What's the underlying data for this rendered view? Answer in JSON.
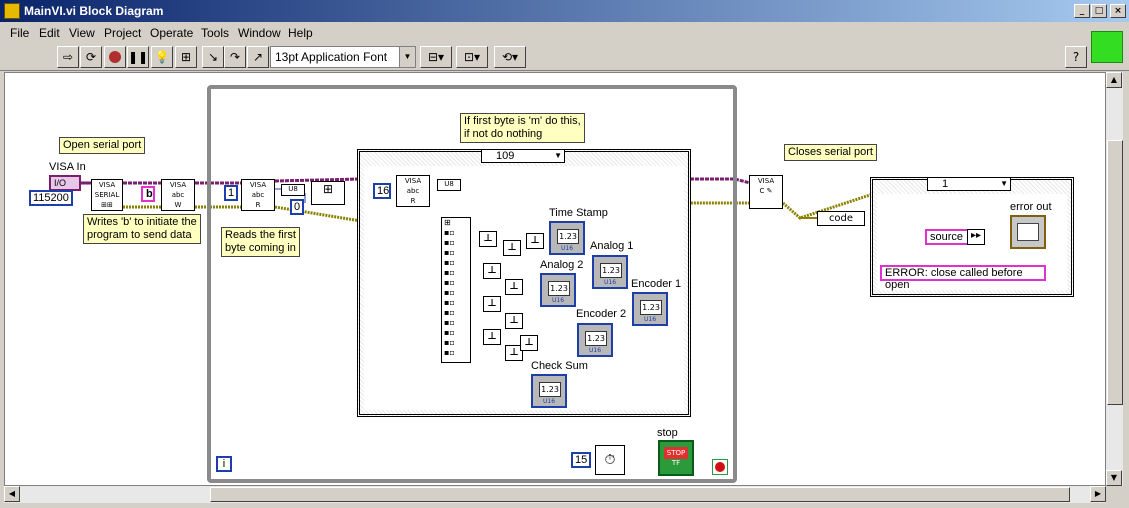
{
  "window": {
    "title": "MainVI.vi Block Diagram"
  },
  "menu": [
    "File",
    "Edit",
    "View",
    "Project",
    "Operate",
    "Tools",
    "Window",
    "Help"
  ],
  "toolbar": {
    "font": "13pt Application Font",
    "help": "?"
  },
  "diagram": {
    "comments": {
      "open_serial": "Open serial port",
      "writes_b_1": "Writes 'b' to initiate the",
      "writes_b_2": "program to send data",
      "reads_first_1": "Reads the first",
      "reads_first_2": "byte coming in",
      "if_first_1": "If first byte is 'm' do this,",
      "if_first_2": "if not do nothing",
      "closes_serial": "Closes serial port"
    },
    "labels": {
      "visa_in": "VISA In",
      "time_stamp": "Time Stamp",
      "analog1": "Analog 1",
      "analog2": "Analog 2",
      "encoder1": "Encoder 1",
      "encoder2": "Encoder 2",
      "check_sum": "Check Sum",
      "stop": "stop",
      "error_out": "error out",
      "code": "code",
      "source": "source"
    },
    "constants": {
      "visa_io": "I/O",
      "baud": "115200",
      "write_char": "b",
      "bytes_to_read": "1",
      "index_zero": "0",
      "bytes_16": "16",
      "wait_ms": "15",
      "error_msg": "ERROR: close called before open",
      "indicator_value": "1.23",
      "indicator_type": "U16",
      "iter": "i",
      "stop_btn": "STOP"
    },
    "case_selectors": {
      "inner": "109",
      "right": "1"
    }
  }
}
